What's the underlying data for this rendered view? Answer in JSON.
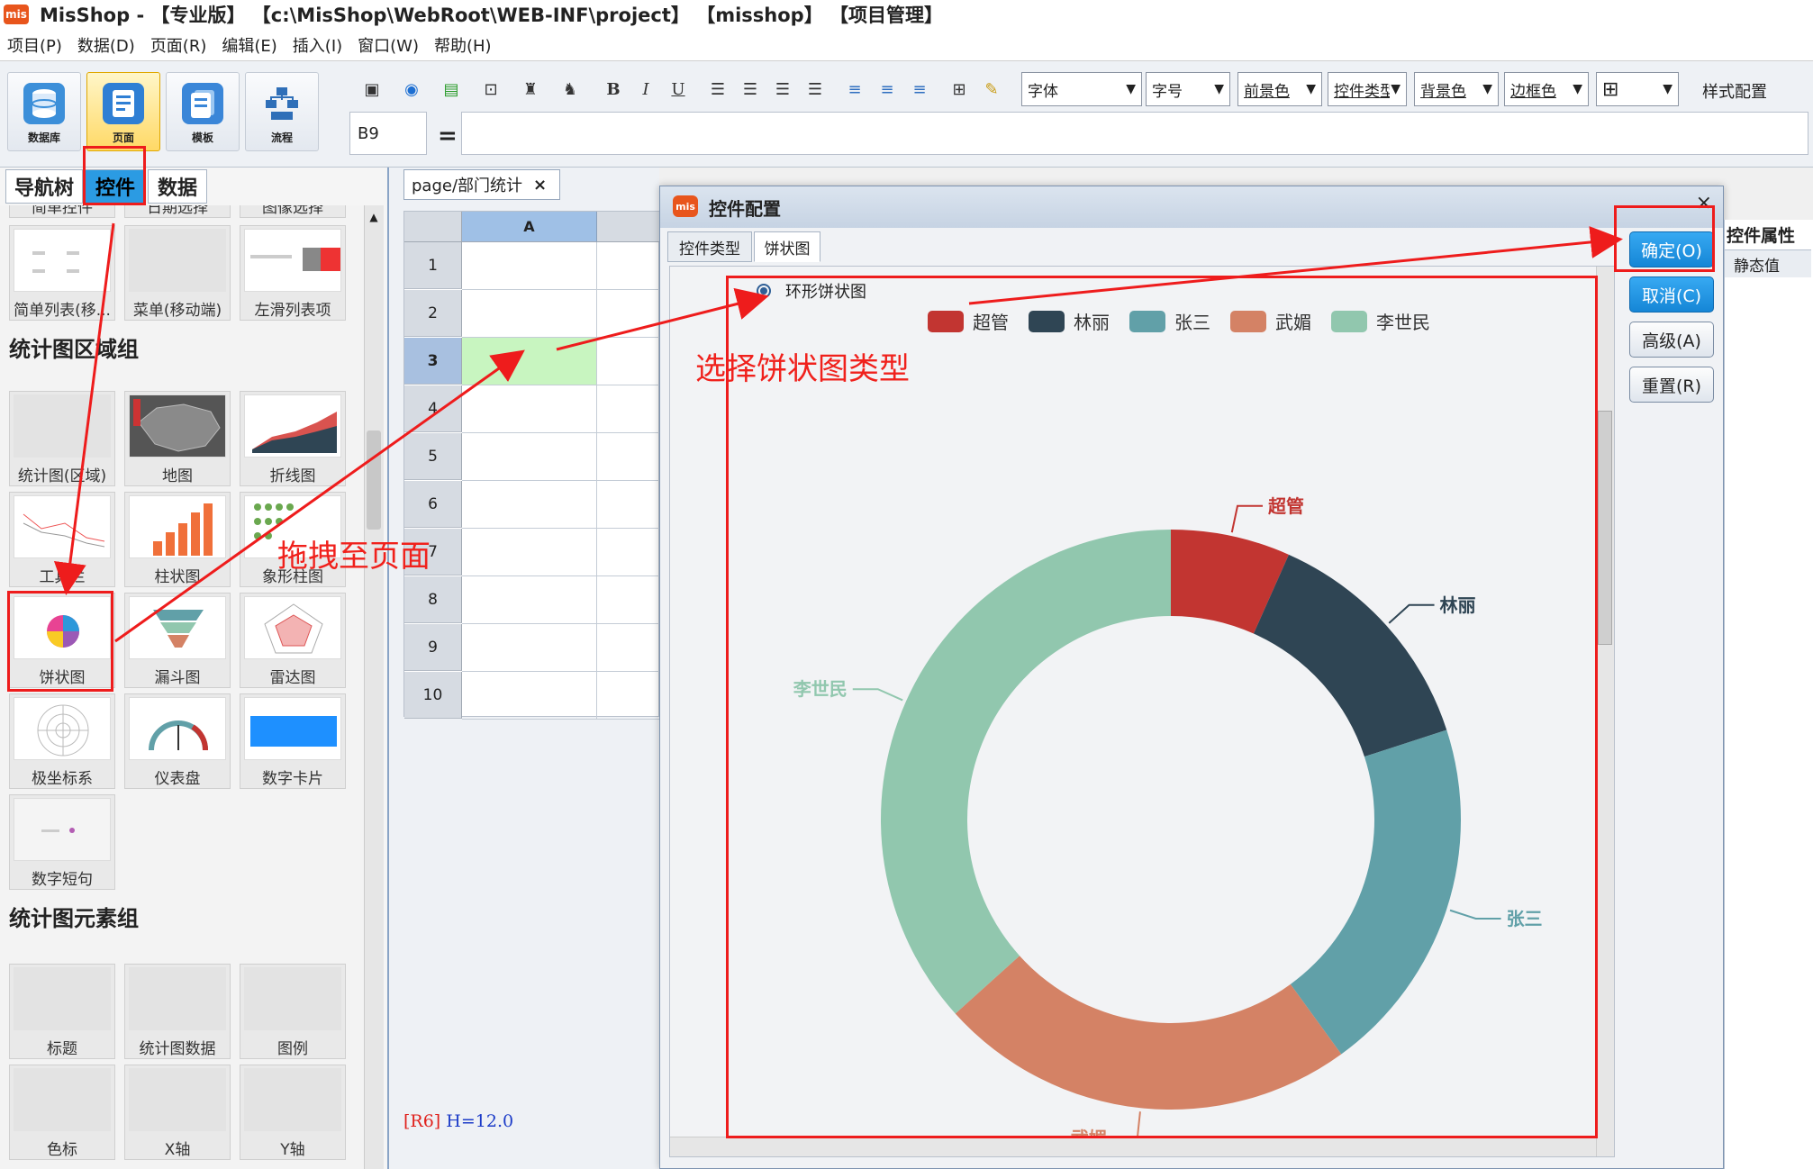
{
  "window": {
    "title": "MisShop - 【专业版】 【c:\\MisShop\\WebRoot\\WEB-INF\\project】 【misshop】 【项目管理】",
    "logo_text": "mis"
  },
  "menu": [
    "项目(P)",
    "数据(D)",
    "页面(R)",
    "编辑(E)",
    "插入(I)",
    "窗口(W)",
    "帮助(H)"
  ],
  "toolbar": {
    "big_buttons": [
      {
        "label": "数据库",
        "icon": "database-icon"
      },
      {
        "label": "页面",
        "icon": "page-icon",
        "active": true
      },
      {
        "label": "模板",
        "icon": "template-icon"
      },
      {
        "label": "流程",
        "icon": "flow-icon"
      }
    ],
    "font_family": "字体",
    "font_size": "字号",
    "fore_color": "前景色",
    "control_type": "控件类型",
    "back_color": "背景色",
    "border_color": "边框色",
    "style_config": "样式配置",
    "cell_ref": "B9",
    "equals": "="
  },
  "left_panel": {
    "tabs": [
      "导航树",
      "控件",
      "数据"
    ],
    "active_tab": "控件",
    "top_partial": [
      "简单控件",
      "日期选择",
      "图像选择"
    ],
    "list_items": [
      "简单列表(移...",
      "菜单(移动端)",
      "左滑列表项"
    ],
    "chart_area_group": {
      "title": "统计图区域组",
      "items": [
        "统计图(区域)",
        "地图",
        "折线图",
        "工具栏",
        "柱状图",
        "象形柱图",
        "饼状图",
        "漏斗图",
        "雷达图",
        "极坐标系",
        "仪表盘",
        "数字卡片",
        "数字短句"
      ]
    },
    "chart_element_group": {
      "title": "统计图元素组",
      "items": [
        "标题",
        "统计图数据",
        "图例",
        "色标",
        "X轴",
        "Y轴"
      ]
    }
  },
  "sheet": {
    "tab": "page/部门统计",
    "column": "A",
    "rows": [
      "1",
      "2",
      "3",
      "4",
      "5",
      "6",
      "7",
      "8",
      "9",
      "10"
    ],
    "selected_row": "3",
    "status_ref": "[R6]",
    "status_text": " H=12.0"
  },
  "dialog": {
    "title": "控件配置",
    "tabs": [
      "控件类型",
      "饼状图"
    ],
    "radio_option": "环形饼状图",
    "buttons": [
      "确定(O)",
      "取消(C)",
      "高级(A)",
      "重置(R)"
    ]
  },
  "right_panel": {
    "title": "控件属性",
    "cell": "静态值"
  },
  "annotations": {
    "drag_hint": "拖拽至页面",
    "select_hint": "选择饼状图类型"
  },
  "colors": {
    "accent_blue": "#2b9be3",
    "annotation_red": "#ee1c1c"
  },
  "chart_data": {
    "type": "pie",
    "variant": "donut",
    "categories": [
      "超管",
      "林丽",
      "张三",
      "武媚",
      "李世民"
    ],
    "values": [
      2,
      4,
      6,
      7,
      11
    ],
    "colors": [
      "#c23531",
      "#2f4554",
      "#61a0a8",
      "#d48265",
      "#91c7ae"
    ],
    "legend_position": "top"
  }
}
